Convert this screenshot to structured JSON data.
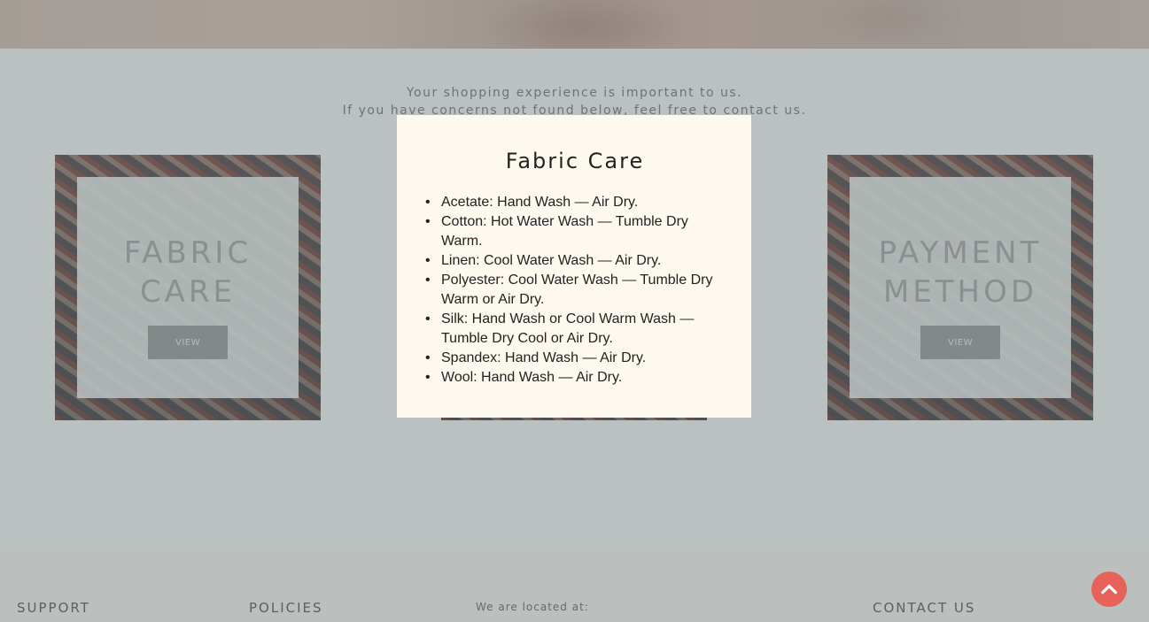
{
  "intro": {
    "line1": "Your shopping experience is important to us.",
    "line2": "If you have concerns not found below, feel free to contact us."
  },
  "cards": {
    "left": {
      "title_line1": "FABRIC",
      "title_line2": "CARE",
      "button": "VIEW"
    },
    "right": {
      "title_line1": "PAYMENT",
      "title_line2": "METHOD",
      "button": "VIEW"
    }
  },
  "footer": {
    "support": "SUPPORT",
    "policies": "POLICIES",
    "location": "We are located at:",
    "contact": "CONTACT US"
  },
  "modal": {
    "title": "Fabric Care",
    "items": [
      "Acetate: Hand Wash — Air Dry.",
      "Cotton: Hot Water Wash — Tumble Dry Warm.",
      "Linen: Cool Water Wash — Air Dry.",
      "Polyester: Cool Water Wash — Tumble Dry Warm or Air Dry.",
      "Silk: Hand Wash or Cool Warm Wash — Tumble Dry Cool or Air Dry.",
      "Spandex: Hand Wash — Air Dry.",
      "Wool: Hand Wash — Air Dry."
    ]
  },
  "scroll_top": {
    "icon": "chevron-up-icon",
    "color": "#e6625a"
  }
}
